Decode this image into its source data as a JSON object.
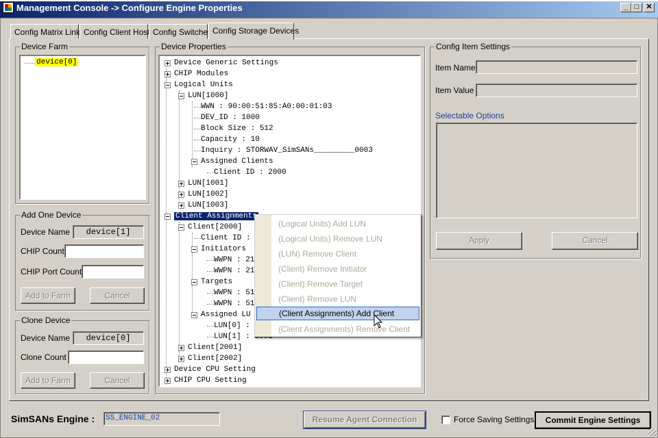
{
  "window": {
    "title": "Management Console -> Configure Engine Properties",
    "controls": {
      "minimize": "_",
      "maximize": "□",
      "close": "✕"
    }
  },
  "tabs": [
    {
      "label": "Config Matrix Links"
    },
    {
      "label": "Config Client Hosts"
    },
    {
      "label": "Config Switches"
    },
    {
      "label": "Config Storage Devices"
    }
  ],
  "device_farm": {
    "legend": "Device Farm",
    "items": [
      {
        "label": "device[0]"
      }
    ]
  },
  "add_device": {
    "legend": "Add One Device",
    "device_name_label": "Device Name",
    "device_name_value": "device[1]",
    "chip_count_label": "CHIP Count",
    "chip_port_count_label": "CHIP Port Count",
    "add_button": "Add to Farm",
    "cancel_button": "Cancel"
  },
  "clone_device": {
    "legend": "Clone Device",
    "device_name_label": "Device Name",
    "device_name_value": "device[0]",
    "clone_count_label": "Clone Count",
    "add_button": "Add to Farm",
    "cancel_button": "Cancel"
  },
  "device_properties": {
    "legend": "Device Properties",
    "tree": [
      {
        "label": "Device Generic Settings"
      },
      {
        "label": "CHIP Modules"
      },
      {
        "label": "Logical Units"
      },
      {
        "label": "LUN[1000]"
      },
      {
        "label": "WWN : 90:00:51:85:A0:00:01:03"
      },
      {
        "label": "DEV_ID : 1000"
      },
      {
        "label": "Block Size : 512"
      },
      {
        "label": "Capacity : 10"
      },
      {
        "label": "Inquiry : STORWAV_SimSANs_________0003"
      },
      {
        "label": "Assigned Clients"
      },
      {
        "label": "Client ID : 2000"
      },
      {
        "label": "LUN[1001]"
      },
      {
        "label": "LUN[1002]"
      },
      {
        "label": "LUN[1003]"
      },
      {
        "label": "Client Assignments"
      },
      {
        "label": "Client[2000]"
      },
      {
        "label": "Client ID :"
      },
      {
        "label": "Initiators"
      },
      {
        "label": "WWPN : 21"
      },
      {
        "label": "WWPN : 21"
      },
      {
        "label": "Targets"
      },
      {
        "label": "WWPN : 51"
      },
      {
        "label": "WWPN : 51"
      },
      {
        "label": "Assigned LU"
      },
      {
        "label": "LUN[0] :"
      },
      {
        "label": "LUN[1] : 1001"
      },
      {
        "label": "Client[2001]"
      },
      {
        "label": "Client[2002]"
      },
      {
        "label": "Device CPU Setting"
      },
      {
        "label": "CHIP CPU Setting"
      }
    ]
  },
  "context_menu": {
    "items": [
      {
        "label": "(Logical Units) Add LUN"
      },
      {
        "label": "(Logical Units) Remove LUN"
      },
      {
        "label": "(LUN) Remove Client"
      },
      {
        "label": "(Client) Remove Initiator"
      },
      {
        "label": "(Client) Remove Target"
      },
      {
        "label": "(Client) Remove LUN"
      },
      {
        "label": "(Client Assignments) Add Client"
      },
      {
        "label": "(Client Assignments) Remove Client"
      }
    ]
  },
  "config_item": {
    "legend": "Config Item Settings",
    "item_name_label": "Item Name",
    "item_value_label": "Item Value",
    "selectable_label": "Selectable Options",
    "apply_button": "Apply",
    "cancel_button": "Cancel"
  },
  "footer": {
    "engine_label": "SimSANs Engine :",
    "engine_value": "SS_ENGINE_02",
    "resume_button": "Resume Agent Connection",
    "force_saving_label": "Force Saving Settings",
    "commit_button": "Commit Engine Settings"
  },
  "colors": {
    "title_start": "#0a246a",
    "title_end": "#a6caf0",
    "selection": "#0a246a",
    "farm_highlight": "#ffff00",
    "link_blue": "#0a246a"
  }
}
